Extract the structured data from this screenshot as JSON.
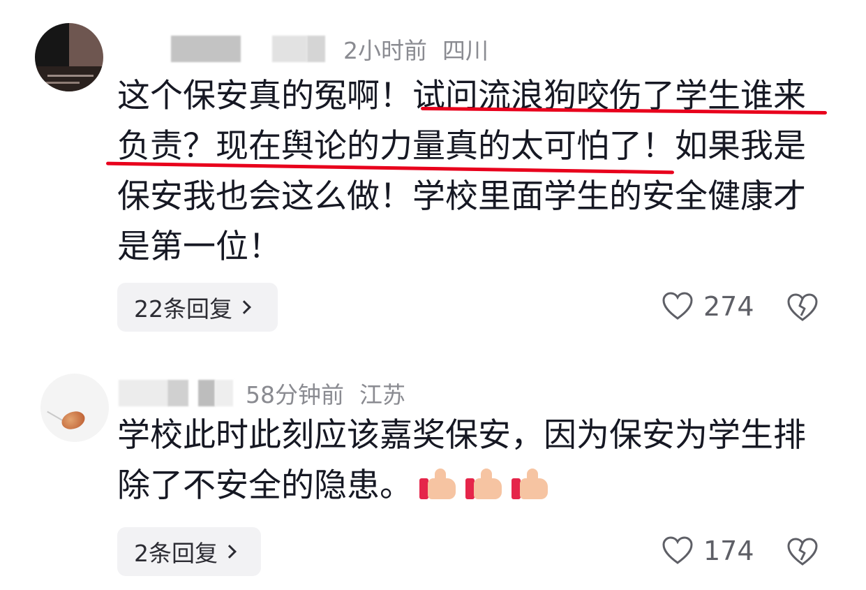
{
  "comments": [
    {
      "time": "2小时前",
      "location": "四川",
      "text": "这个保安真的冤啊！试问流浪狗咬伤了学生谁来负责？现在舆论的力量真的太可怕了！如果我是保安我也会这么做！学校里面学生的安全健康才是第一位！",
      "reply_label": "22条回复",
      "likes": "274"
    },
    {
      "time": "58分钟前",
      "location": "江苏",
      "text": "学校此时此刻应该嘉奖保安，因为保安为学生排除了不安全的隐患。",
      "emoji": [
        "thumbs-up",
        "thumbs-up",
        "thumbs-up"
      ],
      "reply_label": "2条回复",
      "likes": "174"
    }
  ],
  "colors": {
    "highlight_underline": "#e8001c",
    "meta_text": "#8a8b91",
    "reply_bg": "#f2f2f4"
  },
  "icons": [
    "heart-outline-icon",
    "broken-heart-icon",
    "chevron-right-icon"
  ]
}
